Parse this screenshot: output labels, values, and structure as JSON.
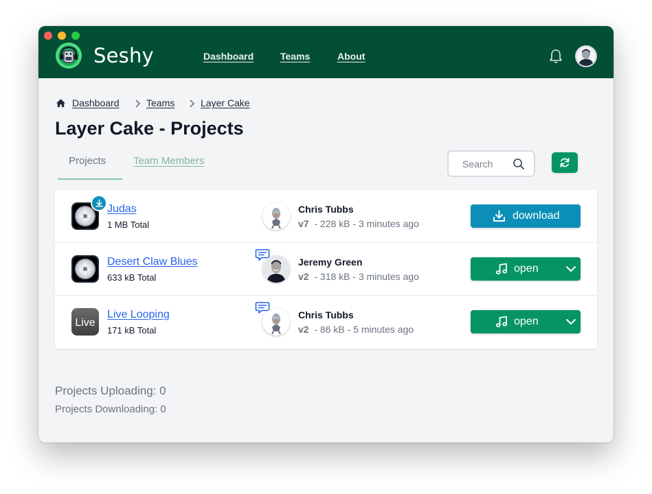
{
  "app": {
    "name": "Seshy"
  },
  "nav": {
    "dashboard": "Dashboard",
    "teams": "Teams",
    "about": "About"
  },
  "icons": {
    "logo": "seshy-robot-logo",
    "notifications": "bell-icon",
    "user": "avatar",
    "home": "home-icon",
    "breadcrumb_separator": "chevron-right-icon",
    "search": "search-icon",
    "refresh": "refresh-icon",
    "comment": "comment-icon",
    "download": "download-icon",
    "music": "music-note-icon",
    "dropdown": "chevron-down-icon"
  },
  "breadcrumb": {
    "dashboard": "Dashboard",
    "teams": "Teams",
    "current": "Layer Cake"
  },
  "page": {
    "title": "Layer Cake - Projects"
  },
  "tabs": {
    "projects": "Projects",
    "members": "Team Members"
  },
  "search": {
    "placeholder": "Search"
  },
  "projects": [
    {
      "name": "Judas",
      "size": "1 MB Total",
      "app_icon": "logic-pro-icon",
      "user": "Chris Tubbs",
      "version": "v7",
      "detail": "- 228 kB - 3 minutes ago",
      "action": "download",
      "has_download_badge": true,
      "has_comment": false
    },
    {
      "name": "Desert Claw Blues",
      "size": "633 kB Total",
      "app_icon": "logic-pro-icon",
      "user": "Jeremy Green",
      "version": "v2",
      "detail": "- 318 kB - 3 minutes ago",
      "action": "open",
      "has_download_badge": false,
      "has_comment": true
    },
    {
      "name": "Live Looping",
      "size": "171 kB Total",
      "app_icon": "ableton-live-icon",
      "app_icon_text": "Live",
      "user": "Chris Tubbs",
      "version": "v2",
      "detail": "- 86 kB - 5 minutes ago",
      "action": "open",
      "has_download_badge": false,
      "has_comment": true
    }
  ],
  "status": {
    "uploading": "Projects Uploading: 0",
    "downloading": "Projects Downloading: 0"
  },
  "colors": {
    "header": "#034f36",
    "primary_green": "#069562",
    "download_blue": "#0b8fb8",
    "link_blue": "#2563eb",
    "background": "#f3f4f6"
  }
}
